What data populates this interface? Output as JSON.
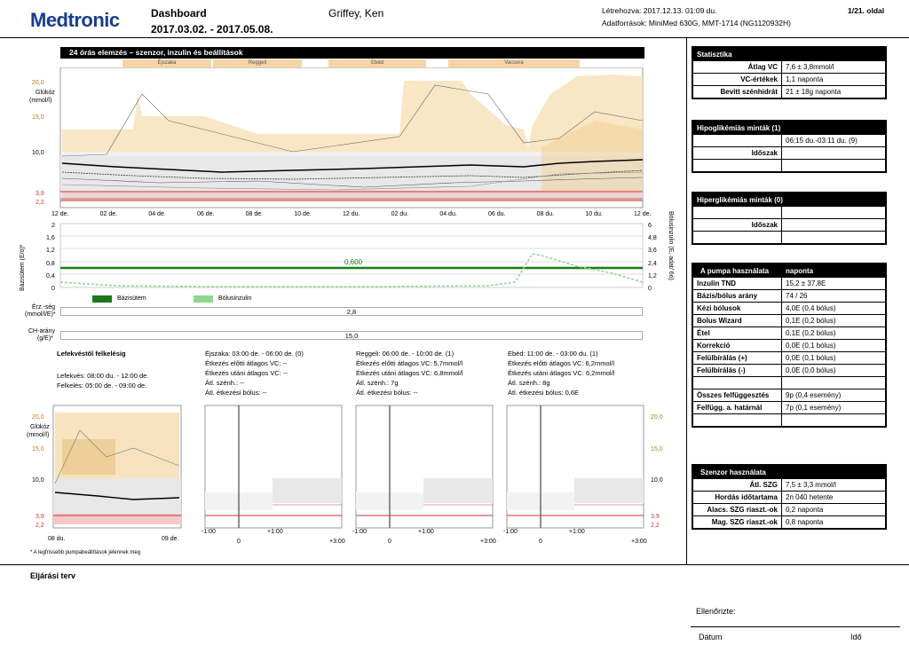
{
  "header": {
    "logo": "Medtronic",
    "title": "Dashboard",
    "date_range": "2017.03.02. - 2017.05.08.",
    "patient": "Griffey, Ken",
    "created": "Létrehozva: 2017.12.13. 01:09 du.",
    "page": "1/21. oldal",
    "sources": "Adatforrások: MiniMed 630G, MMT-1714 (NG1120932H)"
  },
  "panel": {
    "title": "24 órás elemzés – szenzor, inzulin és beállítások",
    "meals": [
      "Éjszaka",
      "Reggeli",
      "Ebéd",
      "Vacsora"
    ]
  },
  "glucose_chart": {
    "ylabel": "Glükóz\n(mmol/l)",
    "ylabel1": "Glükóz",
    "ylabel2": "(mmol/l)",
    "yticks": [
      "20,0",
      "15,0",
      "10,0",
      "3,9",
      "2,2"
    ],
    "xticks": [
      "12 de.",
      "02 de.",
      "04 de.",
      "06 de.",
      "08 de.",
      "10 de.",
      "12 du.",
      "02 du.",
      "04 du.",
      "06 du.",
      "08 du.",
      "10 du.",
      "12 de."
    ]
  },
  "insulin_chart": {
    "ylabel_left": "Bázisütem (E/ó)*",
    "ylabel_right": "Bólusinzulin (E, adat/ 6ó)",
    "yticks_left": [
      "2",
      "1,6",
      "1,2",
      "0,8",
      "0,4",
      "0"
    ],
    "yticks_right": [
      "6",
      "4,8",
      "3,6",
      "2,4",
      "1,2",
      "0"
    ],
    "basal_value": "0,600",
    "legend_basal": "Bázisütem",
    "legend_bolus": "Bólusinzulin",
    "basal_color": "#1a7a1a",
    "bolus_color": "#8fd88f"
  },
  "bars": {
    "erz_label1": "Érz.-ség",
    "erz_label2": "(mmol/l/E)*",
    "erz_value": "2,8",
    "ch_label1": "CH-arány",
    "ch_label2": "(g/E)*",
    "ch_value": "15,0"
  },
  "sleep": {
    "title": "Lefekvéstől felkelésig",
    "bed": "Lefekvés: 08:00 du. - 12:00 de.",
    "wake": "Felkelés: 05:00 de. - 09:00 de."
  },
  "meals": [
    {
      "title": "Éjszaka: 03:00 de. - 06:00 de. (0)",
      "pre": "Étkezés előtti átlagos VC: --",
      "post": "Étkezés utáni átlagos VC: --",
      "carb": "Átl. szénh.: --",
      "bolus": "Átl. étkezési bólus: --"
    },
    {
      "title": "Reggeli: 06:00 de. - 10:00 de. (1)",
      "pre": "Étkezés előtti átlagos VC: 5,7mmol/l",
      "post": "Étkezés utáni átlagos VC: 6,8mmol/l",
      "carb": "Átl. szénh.: 7g",
      "bolus": "Átl. étkezési bólus: --"
    },
    {
      "title": "Ebéd: 11:00 de. - 03:00 du. (1)",
      "pre": "Étkezés előtti átlagos VC: 6,2mmol/l",
      "post": "Étkezés utáni átlagos VC: 6,2mmol/l",
      "carb": "Átl. szénh.: 8g",
      "bolus": "Átl. étkezési bólus: 0,6E"
    }
  ],
  "mini": {
    "sleep_x": [
      "08 du.",
      "09 de."
    ],
    "meal_x": [
      "-1:00",
      "0",
      "+1:00",
      "+3:00"
    ],
    "yticks_right": [
      "20,0",
      "15,0",
      "10,0",
      "3,9",
      "2,2"
    ],
    "yticks_left": [
      "20,0",
      "15,0",
      "10,0",
      "3,9",
      "2,2"
    ]
  },
  "footnote": "* A legfrissebb pumpabeállítások jelennek meg",
  "plan": "Eljárási terv",
  "checked": "Ellenőrizte:",
  "date_label": "Dátum",
  "time_label": "Idő",
  "stats": {
    "title": "Statisztika",
    "rows": [
      [
        "Átlag VC",
        "7,6 ± 3,8mmol/l"
      ],
      [
        "VC-értékek",
        "1,1 naponta"
      ],
      [
        "Bevitt szénhidrát",
        "21 ± 18g naponta"
      ]
    ]
  },
  "hypo": {
    "title": "Hipoglikémiás minták (1)",
    "value": "06:15 du.-03:11 du. (9)",
    "label": "Időszak"
  },
  "hyper": {
    "title": "Hiperglikémiás minták (0)",
    "label": "Időszak"
  },
  "pump": {
    "title": "A pumpa használata",
    "title2": "naponta",
    "rows": [
      [
        "Inzulin TND",
        "15,2 ± 37,8E"
      ],
      [
        "Bázis/bólus arány",
        "74 / 26"
      ],
      [
        "Kézi bólusok",
        "4,0E (0,4 bólus)"
      ],
      [
        "Bolus Wizard",
        "0,1E (0,2 bólus)"
      ],
      [
        "Étel",
        "0,1E (0,2 bólus)"
      ],
      [
        "Korrekció",
        "0,0E (0,1 bólus)"
      ],
      [
        "Felülbírálás (+)",
        "0,0E (0,1 bólus)"
      ],
      [
        "Felülbírálás (-)",
        "0,0E (0,0 bólus)"
      ]
    ],
    "rows2": [
      [
        "Összes felfüggesztés",
        "9p (0,4 esemény)"
      ],
      [
        "Felfügg. a. határnál",
        "7p (0,1 esemény)"
      ]
    ]
  },
  "sensor": {
    "title": "Szenzor használata",
    "rows": [
      [
        "Átl. SZG",
        "7,5 ± 3,3 mmol/l"
      ],
      [
        "Hordás időtartama",
        "2n 040 hetente"
      ],
      [
        "Alacs. SZG riaszt.-ok",
        "0,2 naponta"
      ],
      [
        "Mag. SZG riaszt.-ok",
        "0,8 naponta"
      ]
    ]
  }
}
